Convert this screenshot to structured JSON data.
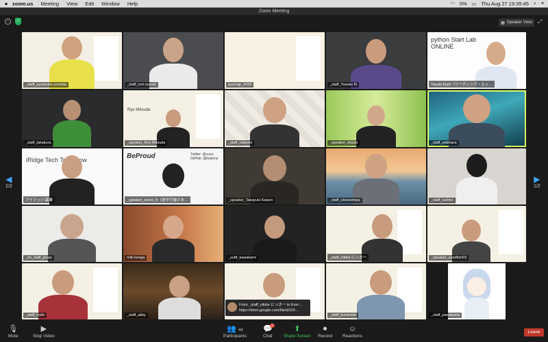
{
  "menubar": {
    "app_name": "zoom.us",
    "items": [
      "Meeting",
      "View",
      "Edit",
      "Window",
      "Help"
    ],
    "battery": "5%",
    "datetime": "Thu Aug 27  19:35:45"
  },
  "window": {
    "title": "Zoom Meeting"
  },
  "topbar": {
    "view_label": "Speaker View"
  },
  "pager": {
    "left": "1/2",
    "right": "1/2"
  },
  "tiles": [
    "_staff_syunsuke yoshida",
    "_staff_nori suzuki",
    "pyconjp_2020",
    "_staff_Yosuke N",
    "Yasuki Kishi（リーディング・エッ…",
    "_staff_takakura",
    "_speaker_Ryo Mitsuda",
    "_staff_nakashi",
    "_speaker_mizuki",
    "_staff_yebihara",
    "アイリッジ-森藤",
    "_speaker_komo_fr（途中で抜けま…",
    "_speaker_Takayuki Kaisen",
    "_staff_utsunomiya",
    "_staff_wahho",
    "_en_staff_jonas",
    "miki kenga",
    "_suttf_kawakami",
    "_staff_nikkie にっきー",
    "_speaker_sandfish03",
    "_staff_nishi",
    "_staff_akky",
    "",
    "_staff_kuramoto",
    "_staff_panakuma"
  ],
  "slides": {
    "python_startlab": "python Start Lab ONLINE",
    "iridge": "iRidge Tech Tomorrow",
    "beproud": "BeProud",
    "mitsuda": "Ryo Mitsuda",
    "twitter": "Twitter: @curry\nGitHub: @kaiseny"
  },
  "chat_popup": {
    "from": "From _staff_nikkie にっきー to Ever…",
    "message": "https://drive.google.com/file/d/1DI…"
  },
  "bottombar": {
    "mute": "Mute",
    "stop_video": "Stop Video",
    "participants": "Participants",
    "participant_count": "44",
    "chat": "Chat",
    "chat_badge": "1",
    "share_screen": "Share Screen",
    "record": "Record",
    "reactions": "Reactions",
    "leave": "Leave"
  }
}
